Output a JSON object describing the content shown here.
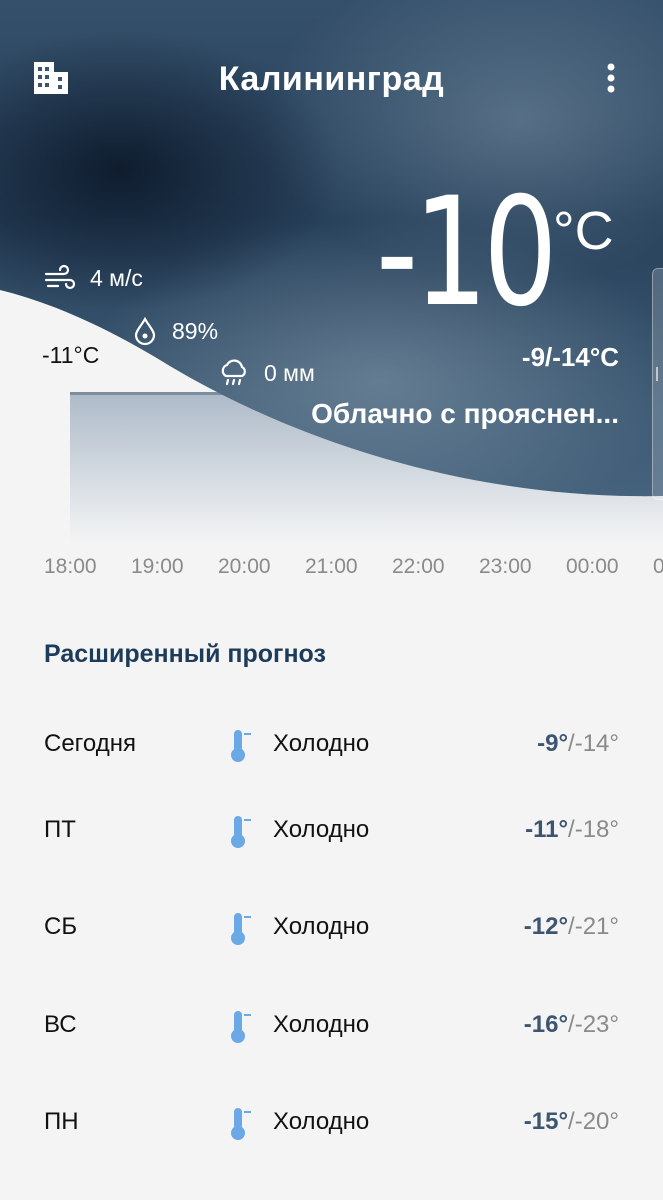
{
  "header": {
    "city": "Калининград"
  },
  "current": {
    "temperature": "-10",
    "unit": "°C",
    "range": "-9/-14°C",
    "condition": "Облачно с прояснен...",
    "wind": "4 м/с",
    "humidity": "89%",
    "precipitation": "0 мм"
  },
  "chart": {
    "current_label": "-11°C"
  },
  "hourly": [
    "18:00",
    "19:00",
    "20:00",
    "21:00",
    "22:00",
    "23:00",
    "00:00",
    "0"
  ],
  "forecast": {
    "title": "Расширенный прогноз",
    "days": [
      {
        "day": "Сегодня",
        "desc": "Холодно",
        "hi": "-9°",
        "lo": "/-14°"
      },
      {
        "day": "ПТ",
        "desc": "Холодно",
        "hi": "-11°",
        "lo": "/-18°"
      },
      {
        "day": "СБ",
        "desc": "Холодно",
        "hi": "-12°",
        "lo": "/-21°"
      },
      {
        "day": "ВС",
        "desc": "Холодно",
        "hi": "-16°",
        "lo": "/-23°"
      },
      {
        "day": "ПН",
        "desc": "Холодно",
        "hi": "-15°",
        "lo": "/-20°"
      }
    ]
  },
  "icons": {
    "city": "city-buildings-icon",
    "menu": "more-vertical-icon",
    "wind": "wind-icon",
    "humidity": "droplet-icon",
    "rain": "rain-cloud-icon",
    "thermometer": "thermometer-icon"
  },
  "colors": {
    "accent": "#1d3b5a",
    "thermometer": "#6aa8e6"
  }
}
